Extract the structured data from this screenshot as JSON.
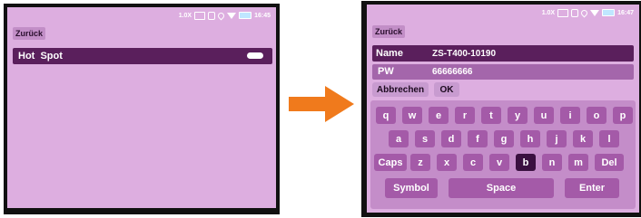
{
  "left_screen": {
    "status": {
      "zoom": "1.0X",
      "time": "16:45"
    },
    "back_label": "Zurück",
    "hotspot_label": "Hot  Spot"
  },
  "right_screen": {
    "status": {
      "zoom": "1.0X",
      "time": "16:47"
    },
    "back_label": "Zurück",
    "name_label": "Name",
    "name_value": "ZS-T400-10190",
    "pw_label": "PW",
    "pw_value": "66666666",
    "cancel_label": "Abbrechen",
    "ok_label": "OK",
    "keyboard": {
      "row1": [
        "q",
        "w",
        "e",
        "r",
        "t",
        "y",
        "u",
        "i",
        "o",
        "p"
      ],
      "row2": [
        "a",
        "s",
        "d",
        "f",
        "g",
        "h",
        "j",
        "k",
        "l"
      ],
      "row3": [
        "Caps",
        "z",
        "x",
        "c",
        "v",
        "b",
        "n",
        "m",
        "Del"
      ],
      "row4": [
        "Symbol",
        "Space",
        "Enter"
      ],
      "selected_key": "b"
    }
  },
  "colors": {
    "screen_bg": "#ddaee0",
    "row_bg": "#5a1f5c",
    "key_bg": "#a45aa8",
    "arrow": "#f07a1c"
  }
}
